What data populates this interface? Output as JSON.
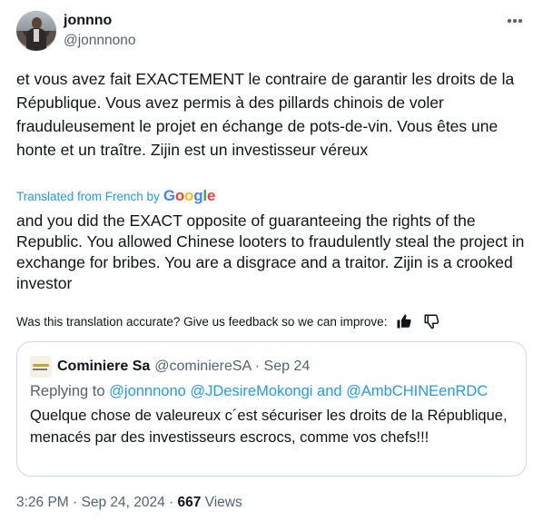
{
  "author": {
    "name": "jonnno",
    "handle": "@jonnnono"
  },
  "tweet": {
    "original_text": "et vous avez fait EXACTEMENT le contraire de garantir les droits de la République. Vous avez permis à des pillards chinois de voler frauduleusement le projet en échange de pots-de-vin. Vous êtes une honte et un traître.  Zijin est un investisseur véreux",
    "translated_from": "Translated from French by",
    "translator_brand": "Google",
    "translation_text": "and you did the EXACT opposite of guaranteeing the rights of the Republic. You allowed Chinese looters to fraudulently steal the project in exchange for bribes. You are a disgrace and a traitor. Zijin is a crooked investor",
    "feedback_prompt": "Was this translation accurate? Give us feedback so we can improve:"
  },
  "quoted_tweet": {
    "name": "Cominiere Sa",
    "handle_date": "@cominiereSA · Sep 24",
    "replying_prefix": "Replying to",
    "mentions": "@jonnnono @JDesireMokongi and @AmbCHINEenRDC",
    "text": "Quelque chose de valeureux  c´est sécuriser les droits de la République,  menacés par des investisseurs escrocs, comme vos chefs!!!"
  },
  "meta": {
    "timestamp": "3:26 PM · Sep 24, 2024 · ",
    "views_count": "667",
    "views_label": " Views"
  },
  "icons": {
    "more": "more-horizontal-icon",
    "thumbs_up": "thumbs-up-icon",
    "thumbs_down": "thumbs-down-icon"
  },
  "colors": {
    "accent": "#1d9bf0",
    "secondary_text": "#536471",
    "primary_text": "#0f1419",
    "border": "#cfd9de"
  }
}
